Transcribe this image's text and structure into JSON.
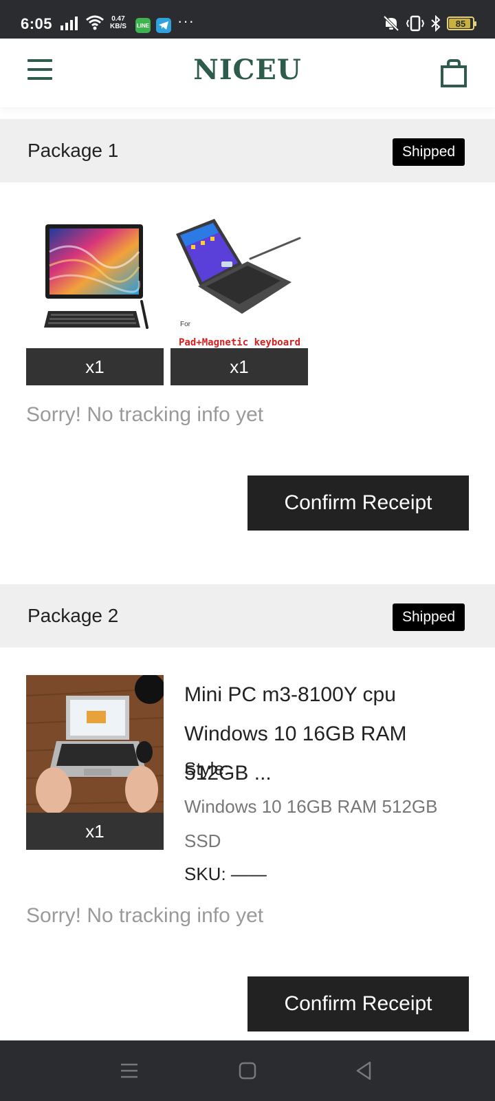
{
  "status_bar": {
    "time": "6:05",
    "net_speed_value": "0.47",
    "net_speed_unit": "KB/S",
    "line_label": "LINE",
    "battery": "85",
    "more": "···",
    "battery_color": "#c9b13e"
  },
  "header": {
    "brand": "NICEU",
    "brand_color": "#2d5c4e"
  },
  "packages": [
    {
      "title": "Package 1",
      "status": "Shipped",
      "items": [
        {
          "qty": "x1"
        },
        {
          "qty": "x1",
          "caption_small": "For",
          "caption": "Pad+Magnetic keyboard"
        }
      ],
      "tracking": "Sorry! No tracking info yet",
      "confirm_label": "Confirm Receipt"
    },
    {
      "title": "Package 2",
      "status": "Shipped",
      "item": {
        "qty": "x1",
        "name": "Mini PC m3-8100Y cpu Windows 10 16GB RAM 512GB ...",
        "style_label": "Style:",
        "style_value": "Windows 10 16GB RAM 512GB SSD",
        "sku": "SKU: ——"
      },
      "tracking": "Sorry! No tracking info yet",
      "confirm_label": "Confirm Receipt"
    }
  ]
}
